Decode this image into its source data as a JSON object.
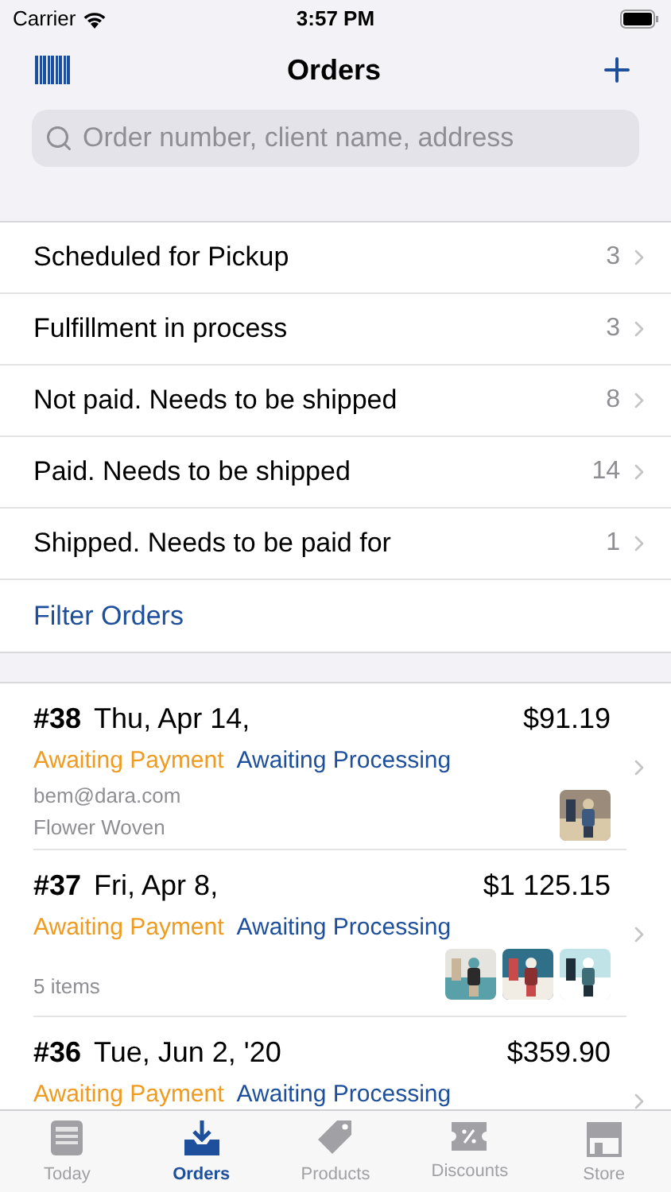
{
  "status_bar": {
    "carrier": "Carrier",
    "time": "3:57 PM"
  },
  "nav": {
    "title": "Orders"
  },
  "search": {
    "placeholder": "Order number, client name, address"
  },
  "filters": [
    {
      "label": "Scheduled for Pickup",
      "count": "3"
    },
    {
      "label": "Fulfillment in process",
      "count": "3"
    },
    {
      "label": "Not paid. Needs to be shipped",
      "count": "8"
    },
    {
      "label": "Paid. Needs to be shipped",
      "count": "14"
    },
    {
      "label": "Shipped. Needs to be paid for",
      "count": "1"
    }
  ],
  "filter_link": "Filter Orders",
  "orders": [
    {
      "number": "#38",
      "date": "Thu, Apr 14,",
      "total": "$91.19",
      "statuses": [
        {
          "label": "Awaiting Payment",
          "color": "#f09a1e"
        },
        {
          "label": "Awaiting Processing",
          "color": "#1d4f9c"
        }
      ],
      "details": [
        "bem@dara.com",
        "Flower Woven"
      ],
      "images": [
        {
          "kind": "picture"
        }
      ]
    },
    {
      "number": "#37",
      "date": "Fri, Apr 8,",
      "total": "$1 125.15",
      "statuses": [
        {
          "label": "Awaiting Payment",
          "color": "#f09a1e"
        },
        {
          "label": "Awaiting Processing",
          "color": "#1d4f9c"
        }
      ],
      "details": [
        "5 items"
      ],
      "images": [
        {
          "kind": "picture"
        },
        {
          "kind": "picture"
        },
        {
          "kind": "picture"
        }
      ]
    },
    {
      "number": "#36",
      "date": "Tue, Jun 2, '20",
      "total": "$359.90",
      "statuses": [
        {
          "label": "Awaiting Payment",
          "color": "#f09a1e"
        },
        {
          "label": "Awaiting Processing",
          "color": "#1d4f9c"
        }
      ]
    }
  ],
  "tabs": [
    {
      "label": "Today",
      "selected": false
    },
    {
      "label": "Orders",
      "selected": true
    },
    {
      "label": "Products",
      "selected": false
    },
    {
      "label": "Discounts",
      "selected": false
    },
    {
      "label": "Store",
      "selected": false
    }
  ]
}
